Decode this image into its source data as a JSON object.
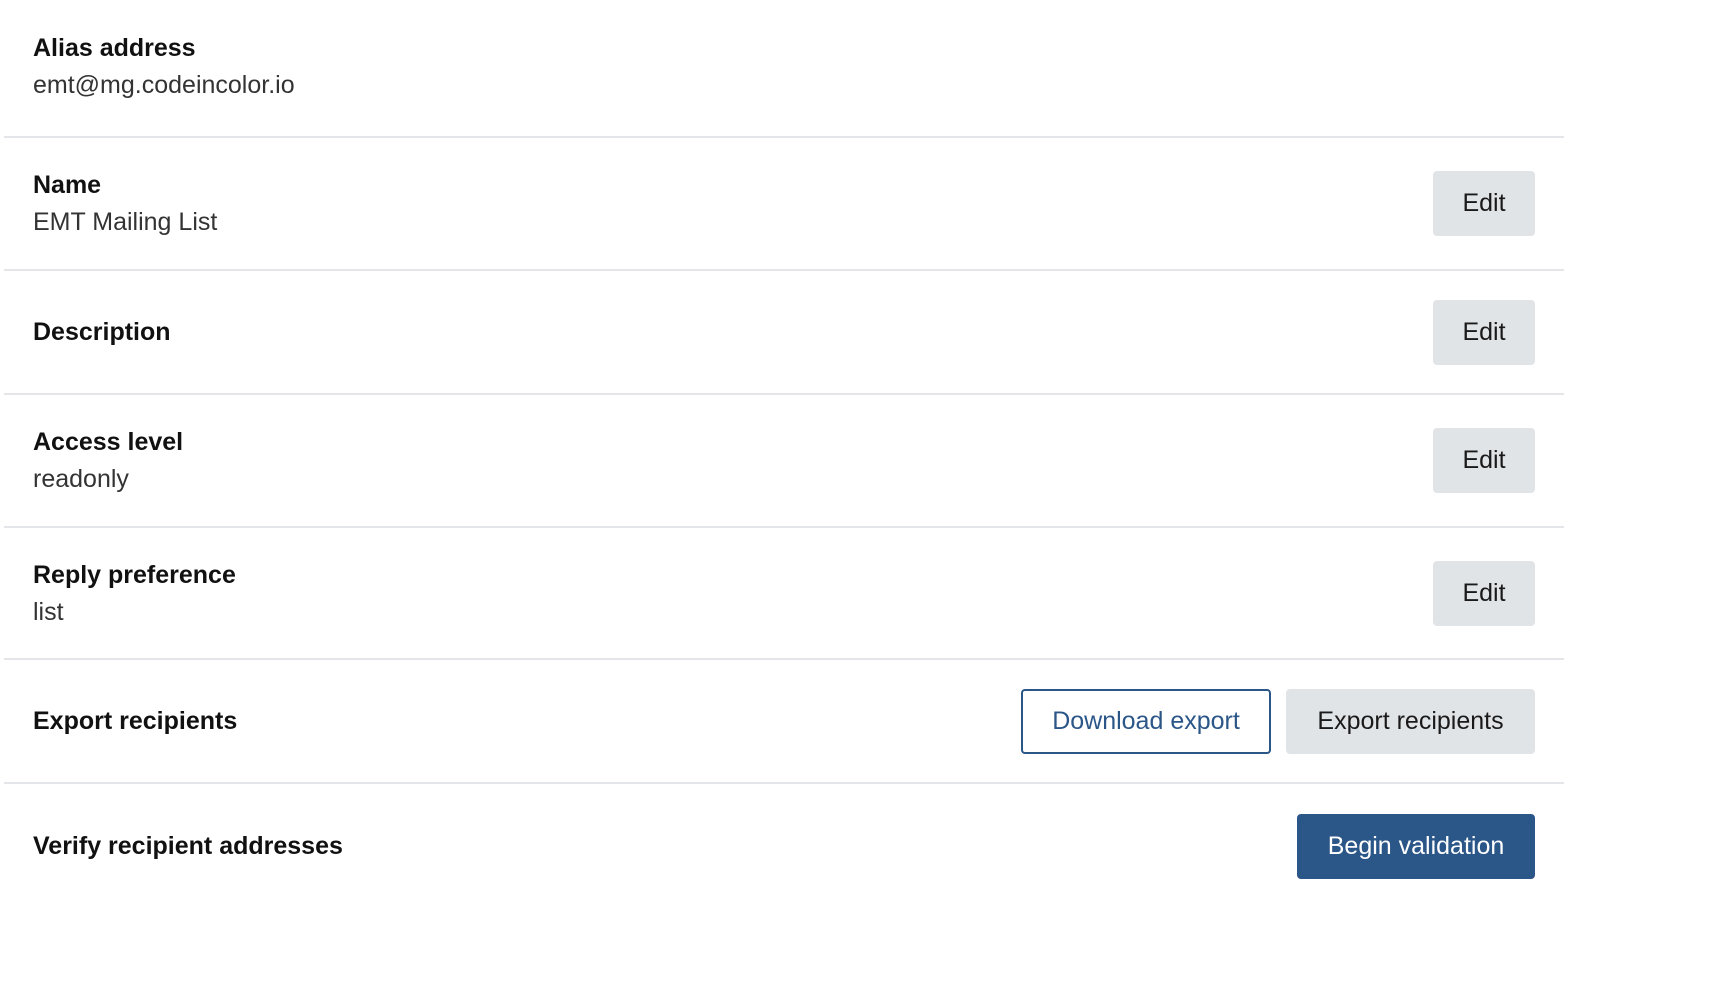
{
  "settings": {
    "alias": {
      "label": "Alias address",
      "value": "emt@mg.codeincolor.io"
    },
    "name": {
      "label": "Name",
      "value": "EMT Mailing List",
      "edit_label": "Edit"
    },
    "description": {
      "label": "Description",
      "edit_label": "Edit"
    },
    "access_level": {
      "label": "Access level",
      "value": "readonly",
      "edit_label": "Edit"
    },
    "reply_preference": {
      "label": "Reply preference",
      "value": "list",
      "edit_label": "Edit"
    },
    "export": {
      "label": "Export recipients",
      "download_label": "Download export",
      "export_label": "Export recipients"
    },
    "verify": {
      "label": "Verify recipient addresses",
      "begin_label": "Begin validation"
    }
  },
  "colors": {
    "primary": "#2b5688",
    "secondary_button": "#e1e4e7",
    "divider": "#e3e5e8"
  }
}
